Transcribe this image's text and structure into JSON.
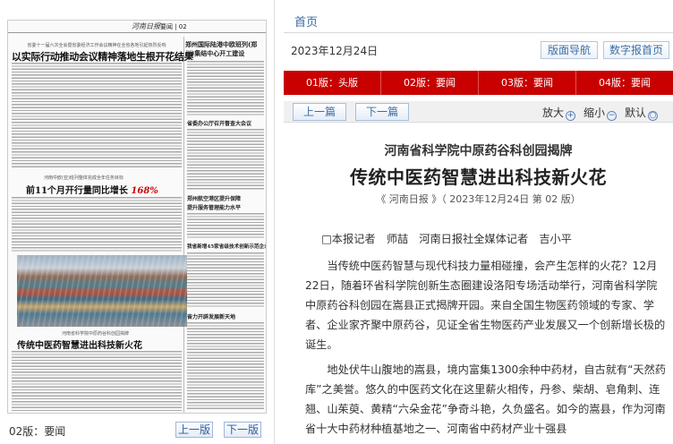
{
  "newspaper": {
    "masthead_logo": "河南日报",
    "masthead_section": "要闻 | 02",
    "top_subheading": "省委十一届六次全会暨省委经济工作会议精神在全省各地引起热烈反响",
    "main_headline": "以实际行动推动会议精神落地生根开花结果",
    "right_box_title": "郑州国际陆港中欧班列(郑州)集结中心开工建设",
    "right_headline_1": "省委办公厅召开督查大会议",
    "mid_subheading": "河南中欧(亚)班列整体完成全年任务目标",
    "mid_headline_prefix": "前11个月开行量同比增长",
    "mid_headline_highlight": "168%",
    "right_headline_2": "郑州航空港区提升保障",
    "right_headline_3": "提升服务管理能力水平",
    "right_headline_4": "我省新增45家省级技术创新示范企业",
    "bottom_subheading": "河南省科学院中原药谷科创园揭牌",
    "bottom_headline": "传统中医药智慧进出科技新火花",
    "right_headline_5": "奋力开辟发展新天地",
    "page_label": "02版：要闻",
    "prev_page_btn": "上一版",
    "next_page_btn": "下一版"
  },
  "header": {
    "home_link": "首页",
    "date": "2023年12月24日",
    "layout_nav_btn": "版面导航",
    "digital_home_btn": "数字报首页"
  },
  "tabs": [
    {
      "label": "01版：头版"
    },
    {
      "label": "02版：要闻"
    },
    {
      "label": "03版：要闻"
    },
    {
      "label": "04版：要闻"
    }
  ],
  "toolbar": {
    "prev_article_btn": "上一篇",
    "next_article_btn": "下一篇",
    "zoom_in_label": "放大",
    "zoom_out_label": "缩小",
    "default_label": "默认",
    "plus_glyph": "+",
    "minus_glyph": "−",
    "default_glyph": "○"
  },
  "article": {
    "kicker": "河南省科学院中原药谷科创园揭牌",
    "title": "传统中医药智慧进出科技新火花",
    "source": "《 河南日报 》（ 2023年12月24日  第 02 版）",
    "byline": "□本报记者　师喆　河南日报社全媒体记者　吉小平",
    "paragraphs": [
      "当传统中医药智慧与现代科技力量相碰撞，会产生怎样的火花？12月22日，随着环省科学院创新生态圈建设洛阳专场活动举行，河南省科学院中原药谷科创园在嵩县正式揭牌开园。来自全国生物医药领域的专家、学者、企业家齐聚中原药谷，见证全省生物医药产业发展又一个创新增长极的诞生。",
      "地处伏牛山腹地的嵩县，境内富集1300余种中药材，自古就有“天然药库”之美誉。悠久的中医药文化在这里薪火相传，丹参、柴胡、皂角刺、连翘、山茱萸、黄精“六朵金花”争奇斗艳，久负盛名。如今的嵩县，作为河南省十大中药材种植基地之一、河南省中药材产业十强县"
    ]
  }
}
